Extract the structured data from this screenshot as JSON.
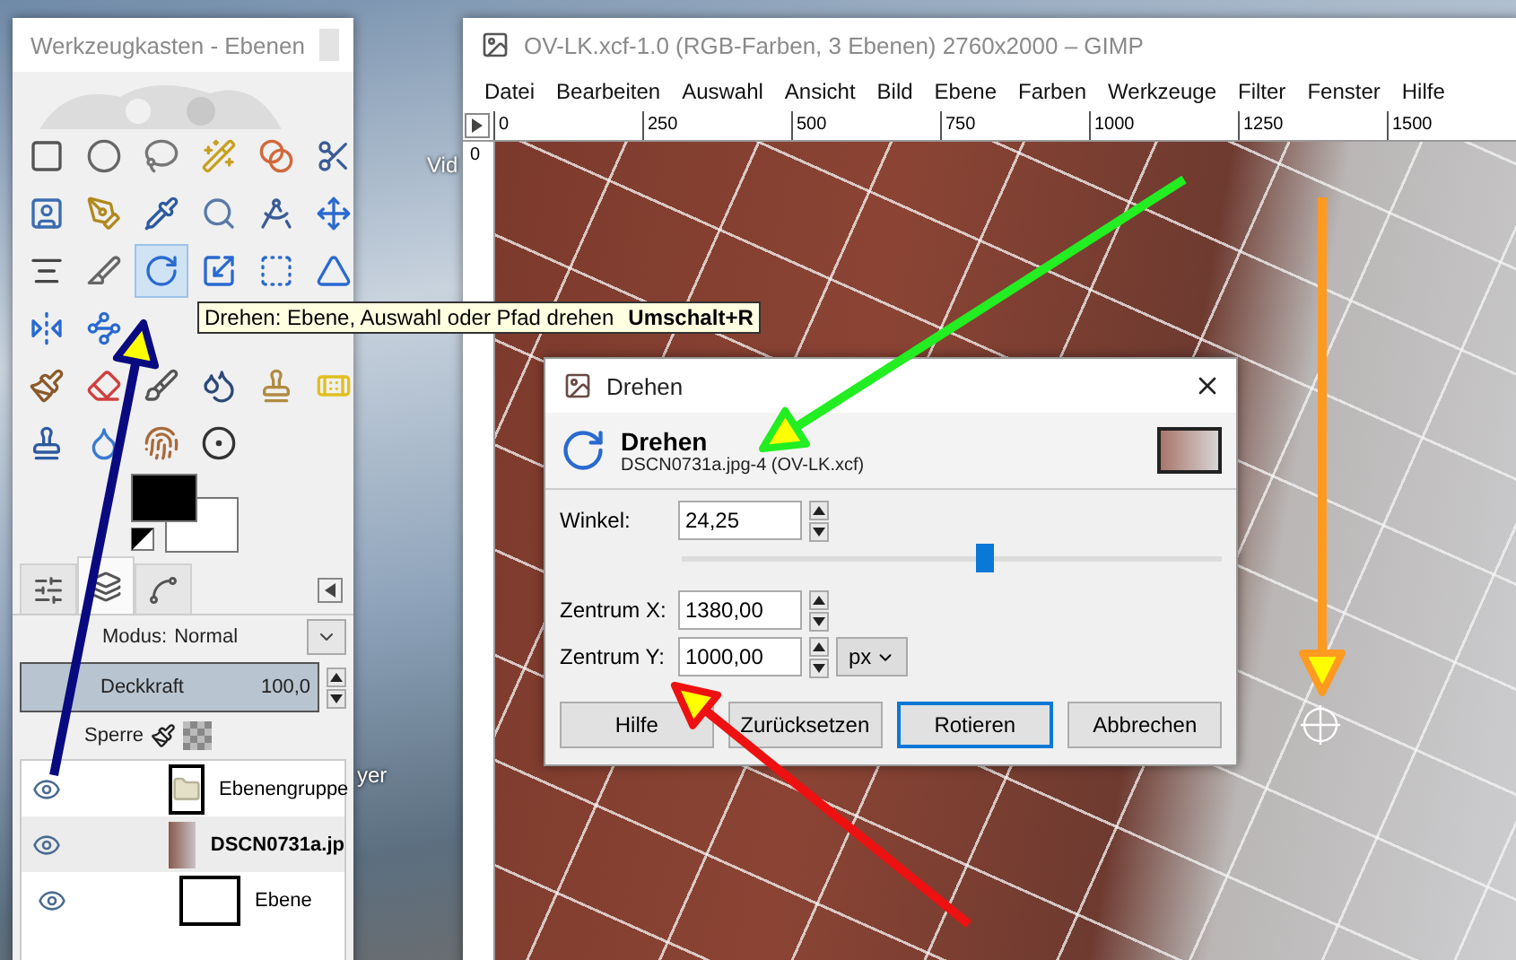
{
  "desktop_labels": [
    "Vid",
    "yer"
  ],
  "toolbox": {
    "title": "Werkzeugkasten - Ebenen",
    "tool_rows": [
      [
        {
          "selected": false
        },
        {
          "selected": false
        },
        {
          "selected": false
        },
        {
          "selected": false
        },
        {
          "selected": false
        },
        {
          "selected": false
        }
      ],
      [
        {
          "selected": false
        },
        {
          "selected": false
        },
        {
          "selected": false
        },
        {
          "selected": false
        },
        {
          "selected": false
        },
        {
          "selected": false
        }
      ],
      [
        {
          "selected": false
        },
        {
          "selected": false
        },
        {
          "selected": true
        },
        {
          "selected": false
        },
        {
          "selected": false
        },
        {
          "selected": false
        }
      ],
      [
        {
          "selected": false
        },
        {
          "selected": false
        }
      ],
      [
        {
          "selected": false
        },
        {
          "selected": false
        },
        {
          "selected": false
        },
        {
          "selected": false
        },
        {
          "selected": false
        },
        {
          "selected": false
        }
      ],
      [
        {
          "selected": false
        },
        {
          "selected": false
        },
        {
          "selected": false
        },
        {
          "selected": false
        }
      ]
    ],
    "tooltip": {
      "text": "Drehen: Ebene, Auswahl oder Pfad drehen",
      "shortcut": "Umschalt+R"
    },
    "dock_tabs": [
      {
        "selected": false
      },
      {
        "selected": true
      },
      {
        "selected": false
      }
    ],
    "mode": {
      "label": "Modus:",
      "value": "Normal"
    },
    "opacity": {
      "label": "Deckkraft",
      "value": "100,0",
      "level": 1
    },
    "lock_label": "Sperre",
    "layers": [
      {
        "name": "Ebenengruppe",
        "kind": "group",
        "selected": false,
        "visible": true
      },
      {
        "name": "DSCN0731a.jp",
        "kind": "image",
        "selected": true,
        "visible": true
      },
      {
        "name": "Ebene",
        "kind": "blank",
        "selected": false,
        "visible": true
      }
    ]
  },
  "gimp": {
    "title": "OV-LK.xcf-1.0 (RGB-Farben, 3 Ebenen) 2760x2000 – GIMP",
    "menu": [
      "Datei",
      "Bearbeiten",
      "Auswahl",
      "Ansicht",
      "Bild",
      "Ebene",
      "Farben",
      "Werkzeuge",
      "Filter",
      "Fenster",
      "Hilfe"
    ],
    "ruler_h": [
      "0",
      "250",
      "500",
      "750",
      "1000",
      "1250",
      "1500"
    ],
    "ruler_v": [
      "0"
    ]
  },
  "dialog": {
    "title": "Drehen",
    "heading": "Drehen",
    "subtitle": "DSCN0731a.jpg-4 (OV-LK.xcf)",
    "angle": {
      "label": "Winkel:",
      "value": "24,25",
      "level": 0.56
    },
    "center_x": {
      "label": "Zentrum X:",
      "value": "1380,00"
    },
    "center_y": {
      "label": "Zentrum Y:",
      "value": "1000,00"
    },
    "unit": "px",
    "buttons": [
      {
        "label": "Hilfe",
        "default": false
      },
      {
        "label": "Zurücksetzen",
        "default": false
      },
      {
        "label": "Rotieren",
        "default": true
      },
      {
        "label": "Abbrechen",
        "default": false
      }
    ]
  }
}
